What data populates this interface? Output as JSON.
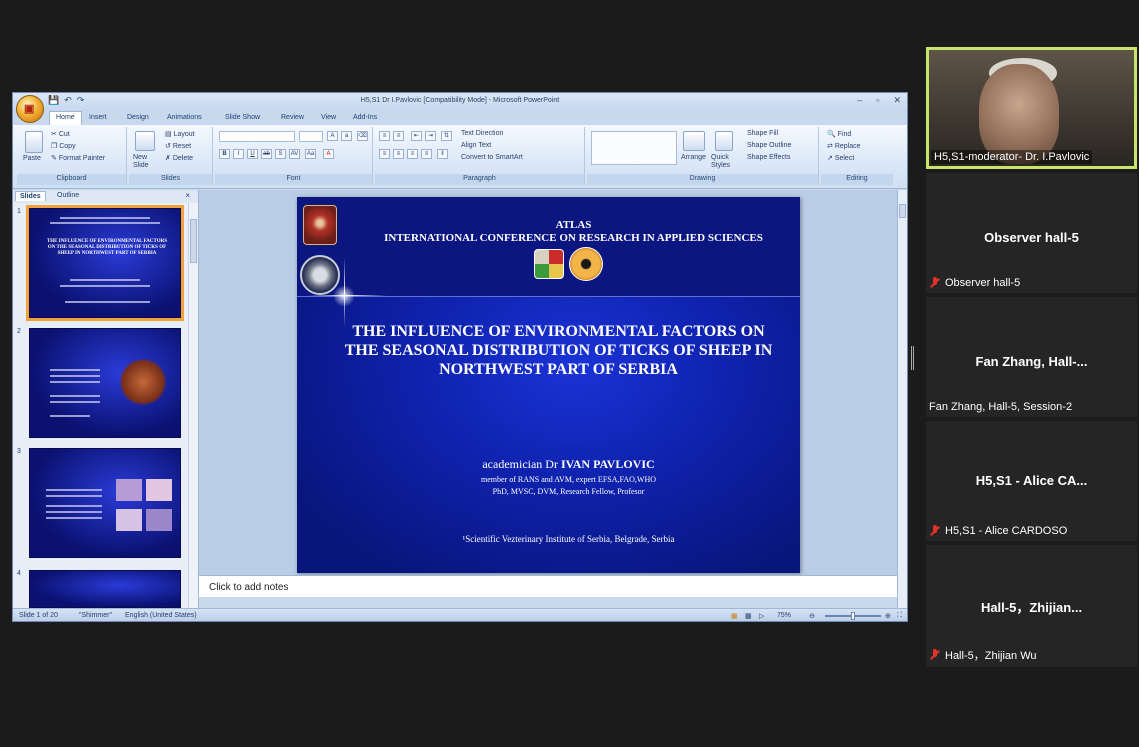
{
  "powerpoint": {
    "title": "H5,S1 Dr I.Pavlovic [Compatibility Mode] - Microsoft PowerPoint",
    "tabs": [
      "Home",
      "Insert",
      "Design",
      "Animations",
      "Slide Show",
      "Review",
      "View",
      "Add-Ins"
    ],
    "ribbon": {
      "clipboard": {
        "paste": "Paste",
        "cut": "Cut",
        "copy": "Copy",
        "format_painter": "Format Painter",
        "label": "Clipboard"
      },
      "slides": {
        "new_slide": "New Slide",
        "layout": "Layout",
        "reset": "Reset",
        "delete": "Delete",
        "label": "Slides"
      },
      "font": {
        "label": "Font"
      },
      "paragraph": {
        "text_direction": "Text Direction",
        "align_text": "Align Text",
        "convert": "Convert to SmartArt",
        "label": "Paragraph"
      },
      "drawing": {
        "arrange": "Arrange",
        "quick_styles": "Quick Styles",
        "shape_fill": "Shape Fill",
        "shape_outline": "Shape Outline",
        "shape_effects": "Shape Effects",
        "label": "Drawing"
      },
      "editing": {
        "find": "Find",
        "replace": "Replace",
        "select": "Select",
        "label": "Editing"
      }
    },
    "pane_tabs": [
      "Slides",
      "Outline"
    ],
    "thumbnail_numbers": [
      "1",
      "2",
      "3",
      "4"
    ],
    "notes_placeholder": "Click to add notes",
    "status": {
      "slide": "Slide 1 of 20",
      "theme": "\"Shimmer\"",
      "language": "English (United States)",
      "zoom": "75%"
    }
  },
  "slide": {
    "heading1": "ATLAS",
    "heading2": "INTERNATIONAL CONFERENCE ON RESEARCH IN APPLIED SCIENCES",
    "title": "THE INFLUENCE OF ENVIRONMENTAL FACTORS ON THE SEASONAL DISTRIBUTION OF TICKS OF SHEEP IN NORTHWEST PART OF SERBIA",
    "author_prefix": "academician Dr",
    "author_name": "IVAN PAVLOVIC",
    "member": "member of RANS and AVM, expert EFSA,FAO,WHO",
    "degrees": "PhD, MVSC, DVM, Research Fellow, Profesor",
    "institute": "¹Scientific Vezterinary Institute of Serbia, Belgrade, Serbia"
  },
  "participants": {
    "moderator_label": "H5,S1-moderator- Dr. I.Pavlovic",
    "tiles": [
      {
        "name": "Observer hall-5",
        "label": "Observer hall-5",
        "muted": true
      },
      {
        "name": "Fan Zhang, Hall-...",
        "label": "Fan Zhang, Hall-5, Session-2",
        "muted": false
      },
      {
        "name": "H5,S1 - Alice CA...",
        "label": "H5,S1 - Alice CARDOSO",
        "muted": true
      },
      {
        "name": "Hall-5，Zhijian...",
        "label": "Hall-5，Zhijian Wu",
        "muted": true
      }
    ]
  },
  "colors": {
    "slide_blue": "#0f22ad",
    "active_speaker": "#c7e56b",
    "muted_mic": "#e0342b"
  }
}
